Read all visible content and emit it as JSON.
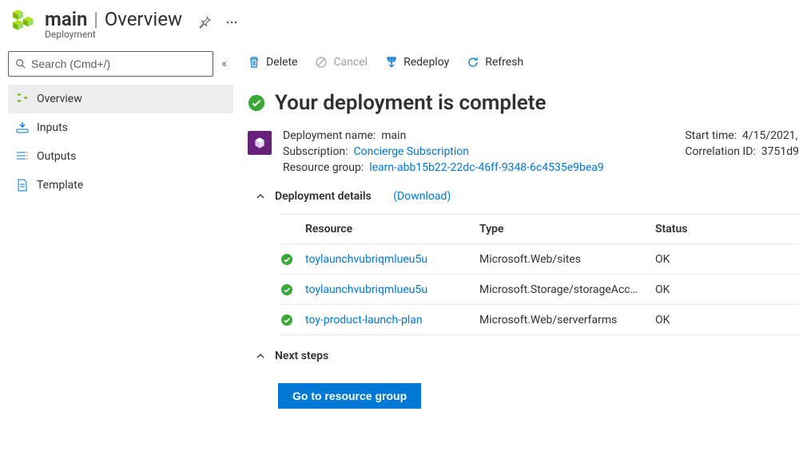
{
  "header": {
    "resource_name": "main",
    "page_name": "Overview",
    "subtitle": "Deployment"
  },
  "search": {
    "placeholder": "Search (Cmd+/)"
  },
  "nav": {
    "items": [
      {
        "label": "Overview"
      },
      {
        "label": "Inputs"
      },
      {
        "label": "Outputs"
      },
      {
        "label": "Template"
      }
    ]
  },
  "toolbar": {
    "delete": "Delete",
    "cancel": "Cancel",
    "redeploy": "Redeploy",
    "refresh": "Refresh"
  },
  "status": {
    "title": "Your deployment is complete"
  },
  "info": {
    "deploy_name_label": "Deployment name:",
    "deploy_name_value": "main",
    "subscription_label": "Subscription:",
    "subscription_link": "Concierge Subscription",
    "rg_label": "Resource group:",
    "rg_link": "learn-abb15b22-22dc-46ff-9348-6c4535e9bea9",
    "start_time_label": "Start time:",
    "start_time_value": "4/15/2021,",
    "correlation_label": "Correlation ID:",
    "correlation_value": "3751d9"
  },
  "details_section": {
    "title": "Deployment details",
    "download": "(Download)",
    "columns": {
      "resource": "Resource",
      "type": "Type",
      "status": "Status"
    },
    "rows": [
      {
        "resource": "toylaunchvubriqmlueu5u",
        "type": "Microsoft.Web/sites",
        "status": "OK"
      },
      {
        "resource": "toylaunchvubriqmlueu5u",
        "type": "Microsoft.Storage/storageAcc…",
        "status": "OK"
      },
      {
        "resource": "toy-product-launch-plan",
        "type": "Microsoft.Web/serverfarms",
        "status": "OK"
      }
    ]
  },
  "next_steps": {
    "title": "Next steps",
    "button": "Go to resource group"
  }
}
